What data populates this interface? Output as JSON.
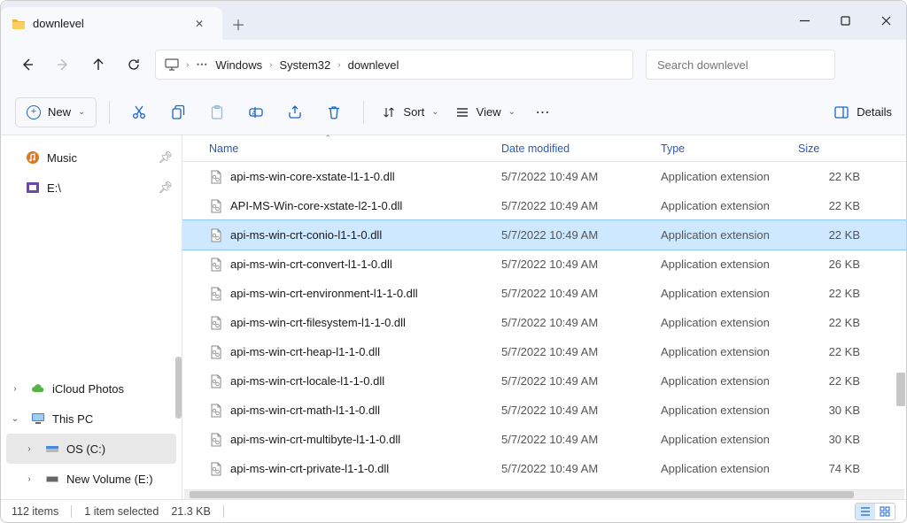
{
  "tab": {
    "title": "downlevel"
  },
  "breadcrumb": {
    "items": [
      "Windows",
      "System32",
      "downlevel"
    ]
  },
  "search": {
    "placeholder": "Search downlevel"
  },
  "toolbar": {
    "new": "New",
    "sort": "Sort",
    "view": "View",
    "details": "Details"
  },
  "sidebar": {
    "top": [
      {
        "label": "Music",
        "icon": "music"
      },
      {
        "label": "E:\\",
        "icon": "drive-e"
      }
    ],
    "bottom": [
      {
        "label": "iCloud Photos",
        "icon": "icloud",
        "expand": "›"
      },
      {
        "label": "This PC",
        "icon": "thispc",
        "expand": "⌄"
      },
      {
        "label": "OS (C:)",
        "icon": "drive-c",
        "expand": "›",
        "selected": true,
        "indent": true
      },
      {
        "label": "New Volume (E:)",
        "icon": "drive-e2",
        "expand": "›",
        "indent": true
      }
    ]
  },
  "columns": {
    "name": "Name",
    "date": "Date modified",
    "type": "Type",
    "size": "Size"
  },
  "files": [
    {
      "name": "api-ms-win-core-xstate-l1-1-0.dll",
      "date": "5/7/2022 10:49 AM",
      "type": "Application extension",
      "size": "22 KB"
    },
    {
      "name": "API-MS-Win-core-xstate-l2-1-0.dll",
      "date": "5/7/2022 10:49 AM",
      "type": "Application extension",
      "size": "22 KB"
    },
    {
      "name": "api-ms-win-crt-conio-l1-1-0.dll",
      "date": "5/7/2022 10:49 AM",
      "type": "Application extension",
      "size": "22 KB",
      "selected": true
    },
    {
      "name": "api-ms-win-crt-convert-l1-1-0.dll",
      "date": "5/7/2022 10:49 AM",
      "type": "Application extension",
      "size": "26 KB"
    },
    {
      "name": "api-ms-win-crt-environment-l1-1-0.dll",
      "date": "5/7/2022 10:49 AM",
      "type": "Application extension",
      "size": "22 KB"
    },
    {
      "name": "api-ms-win-crt-filesystem-l1-1-0.dll",
      "date": "5/7/2022 10:49 AM",
      "type": "Application extension",
      "size": "22 KB"
    },
    {
      "name": "api-ms-win-crt-heap-l1-1-0.dll",
      "date": "5/7/2022 10:49 AM",
      "type": "Application extension",
      "size": "22 KB"
    },
    {
      "name": "api-ms-win-crt-locale-l1-1-0.dll",
      "date": "5/7/2022 10:49 AM",
      "type": "Application extension",
      "size": "22 KB"
    },
    {
      "name": "api-ms-win-crt-math-l1-1-0.dll",
      "date": "5/7/2022 10:49 AM",
      "type": "Application extension",
      "size": "30 KB"
    },
    {
      "name": "api-ms-win-crt-multibyte-l1-1-0.dll",
      "date": "5/7/2022 10:49 AM",
      "type": "Application extension",
      "size": "30 KB"
    },
    {
      "name": "api-ms-win-crt-private-l1-1-0.dll",
      "date": "5/7/2022 10:49 AM",
      "type": "Application extension",
      "size": "74 KB"
    }
  ],
  "status": {
    "count": "112 items",
    "selected": "1 item selected",
    "size": "21.3 KB"
  }
}
